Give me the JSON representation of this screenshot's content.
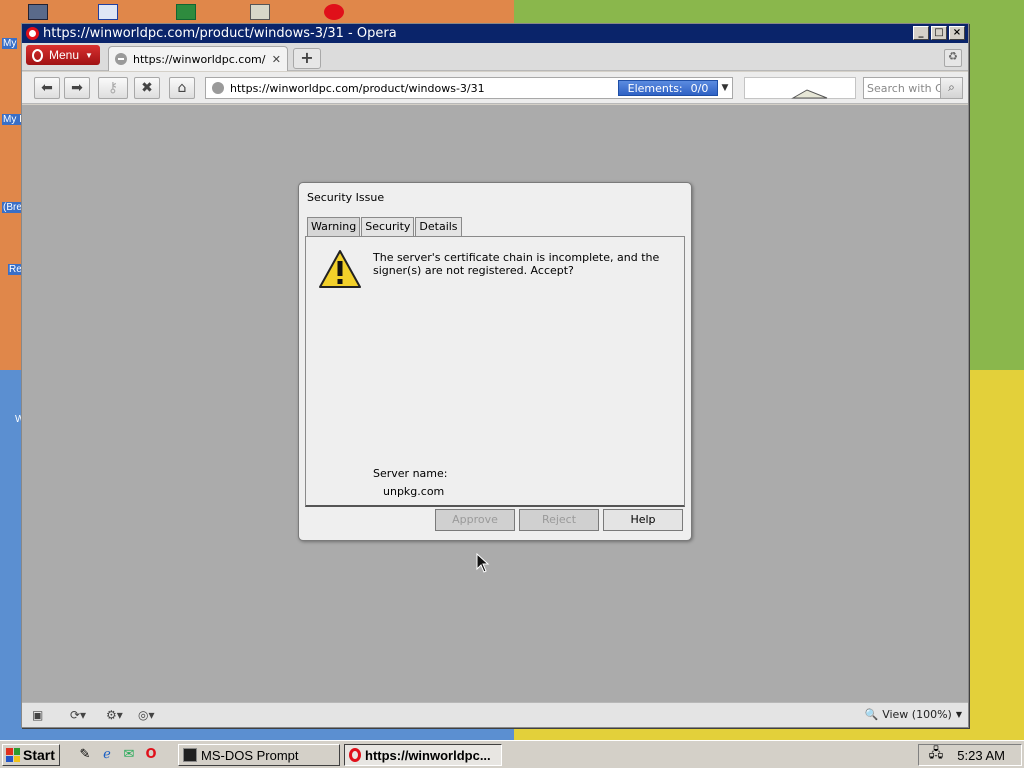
{
  "desktop": {
    "labels": [
      "My",
      "My I",
      "(Bre",
      "Re",
      "W"
    ]
  },
  "window": {
    "title": "https://winworldpc.com/product/windows-3/31 - Opera",
    "minimize": "_",
    "maximize": "□",
    "close": "×"
  },
  "tabbar": {
    "menu_label": "Menu",
    "tab_title": "https://winworldpc.com/...",
    "new_tab": "+"
  },
  "navbar": {
    "url": "https://winworldpc.com/product/windows-3/31",
    "elements_label": "Elements:",
    "elements_count": "0/0",
    "search_placeholder": "Search with Co"
  },
  "dialog": {
    "title": "Security Issue",
    "tabs": [
      "Warning",
      "Security",
      "Details"
    ],
    "message": "The server's certificate chain is incomplete, and the signer(s) are not registered. Accept?",
    "server_name_label": "Server name:",
    "server_name_value": "unpkg.com",
    "buttons": {
      "approve": "Approve",
      "reject": "Reject",
      "help": "Help"
    }
  },
  "statusbar": {
    "zoom_label": "View (100%)"
  },
  "taskbar": {
    "start": "Start",
    "tasks": [
      "MS-DOS Prompt",
      "https://winworldpc..."
    ],
    "clock": "5:23 AM"
  },
  "colors": {
    "titlebar": "#0a246a",
    "content_bg": "#ababab",
    "opera_red": "#e0101a",
    "elements_blue": "#2f62c4"
  }
}
